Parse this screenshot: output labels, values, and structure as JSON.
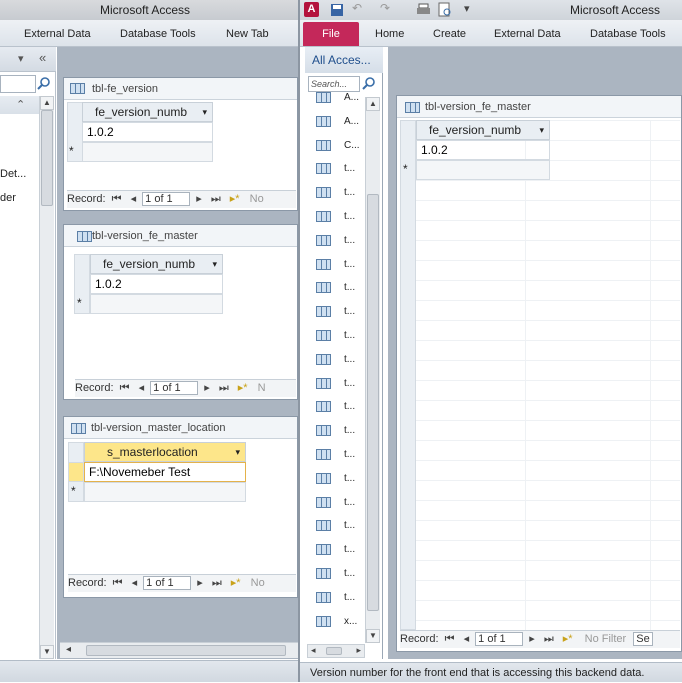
{
  "left_app": {
    "title": "Microsoft Access",
    "tabs": [
      "External Data",
      "Database Tools",
      "New Tab"
    ],
    "nav_items": [
      "Det...",
      "der"
    ],
    "windows": [
      {
        "title": "tbl-fe_version",
        "column": "fe_version_numb",
        "value": "1.0.2",
        "record_label": "Record:",
        "record": "1 of 1",
        "filter": "No"
      },
      {
        "title": "tbl-version_fe_master",
        "column": "fe_version_numb",
        "value": "1.0.2",
        "record_label": "Record:",
        "record": "1 of 1",
        "filter": "N"
      },
      {
        "title": "tbl-version_master_location",
        "column": "s_masterlocation",
        "value": "F:\\Novemeber Test",
        "record_label": "Record:",
        "record": "1 of 1",
        "filter": "No"
      }
    ]
  },
  "right_app": {
    "title": "Microsoft Access",
    "file_label": "File",
    "tabs": [
      "Home",
      "Create",
      "External Data",
      "Database Tools"
    ],
    "nav_pane": {
      "header": "All Acces...",
      "search_placeholder": "Search...",
      "items": [
        "A...",
        "A...",
        "C...",
        "t...",
        "t...",
        "t...",
        "t...",
        "t...",
        "t...",
        "t...",
        "t...",
        "t...",
        "t...",
        "t...",
        "t...",
        "t...",
        "t...",
        "t...",
        "t...",
        "t...",
        "t...",
        "t...",
        "x..."
      ]
    },
    "window": {
      "title": "tbl-version_fe_master",
      "column": "fe_version_numb",
      "value": "1.0.2",
      "record_label": "Record:",
      "record": "1 of 1",
      "filter": "No Filter",
      "search": "Se"
    },
    "status": "Version number for the front end that is accessing this backend data."
  },
  "symbols": {
    "new_row": "*",
    "first": "⏮",
    "prev": "◂",
    "next": "▸",
    "last": "⏭",
    "new": "▸*",
    "dropdown": "▾",
    "collapse": "«",
    "up": "▲",
    "down": "▼",
    "left": "◂",
    "right": "▸",
    "chev_up": "⌃"
  },
  "colors": {
    "file_tab": "#c4285a",
    "workspace": "#abb5c1",
    "highlight": "#fde68a"
  }
}
